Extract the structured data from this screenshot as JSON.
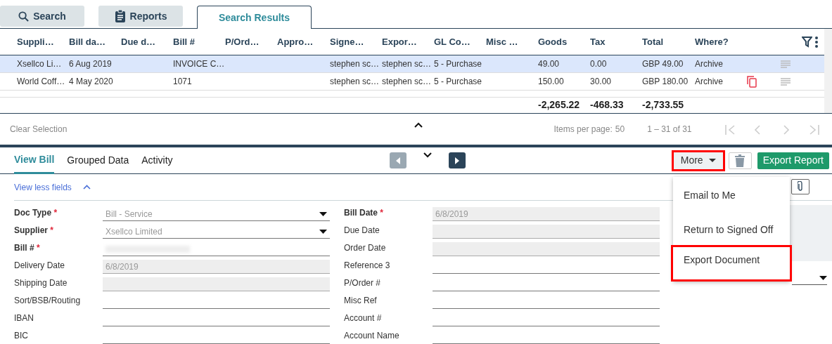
{
  "top_tabs": [
    {
      "label": "Search",
      "selected": false
    },
    {
      "label": "Reports",
      "selected": false
    },
    {
      "label": "Search Results",
      "selected": true
    }
  ],
  "required_marker": "*",
  "table": {
    "columns": [
      "Suppli…",
      "Bill da…",
      "Due d…",
      "Bill #",
      "P/Ord…",
      "Appro…",
      "Signe…",
      "Expor…",
      "GL Co…",
      "Misc …",
      "Goods",
      "Tax",
      "Total",
      "Where?"
    ],
    "rows": [
      {
        "selected": true,
        "copy_flag": false,
        "cells": [
          "Xsellco Li…",
          "6 Aug 2019",
          "",
          "INVOICE C…",
          "",
          "",
          "stephen sc…",
          "stephen sc…",
          "5 - Purchase",
          "",
          "49.00",
          "0.00",
          "GBP 49.00",
          "Archive"
        ]
      },
      {
        "selected": false,
        "copy_flag": true,
        "cells": [
          "World Coff…",
          "4 May 2020",
          "",
          "1071",
          "",
          "",
          "stephen sc…",
          "stephen sc…",
          "5 - Purchase",
          "",
          "150.00",
          "30.00",
          "GBP 180.00",
          "Archive"
        ]
      }
    ],
    "totals": {
      "goods": "-2,265.22",
      "tax": "-468.33",
      "total": "-2,733.55"
    }
  },
  "pager": {
    "clear": "Clear Selection",
    "items_per_page_label": "Items per page:",
    "items_per_page": "50",
    "range": "1 – 31 of 31"
  },
  "detail_tabs": [
    {
      "label": "View Bill",
      "selected": true
    },
    {
      "label": "Grouped Data",
      "selected": false
    },
    {
      "label": "Activity",
      "selected": false
    }
  ],
  "actions": {
    "more": "More",
    "export_report": "Export Report",
    "more_highlighted": true
  },
  "menu": [
    {
      "label": "Email to Me",
      "highlighted": false
    },
    {
      "label": "Return to Signed Off",
      "highlighted": false
    },
    {
      "label": "Export Document",
      "highlighted": true
    }
  ],
  "view_less": "View less fields",
  "left_fields": [
    {
      "label": "Doc Type",
      "required": true,
      "kind": "select",
      "value": "Bill - Service",
      "readonly": false
    },
    {
      "label": "Supplier",
      "required": true,
      "kind": "select",
      "value": "Xsellco Limited",
      "readonly": false
    },
    {
      "label": "Bill #",
      "required": true,
      "kind": "redacted",
      "readonly": false
    },
    {
      "label": "Delivery Date",
      "required": false,
      "kind": "text",
      "value": "6/8/2019",
      "readonly": true
    },
    {
      "label": "Shipping Date",
      "required": false,
      "kind": "text",
      "readonly": true
    },
    {
      "label": "Sort/BSB/Routing",
      "required": false,
      "kind": "text",
      "readonly": false
    },
    {
      "label": "IBAN",
      "required": false,
      "kind": "text",
      "readonly": false
    },
    {
      "label": "BIC",
      "required": false,
      "kind": "text",
      "readonly": false
    }
  ],
  "right_fields": [
    {
      "label": "Bill Date",
      "required": true,
      "value": "6/8/2019",
      "readonly": true
    },
    {
      "label": "Due Date",
      "required": false,
      "readonly": true
    },
    {
      "label": "Order Date",
      "required": false,
      "readonly": true
    },
    {
      "label": "Reference 3",
      "required": false,
      "readonly": false
    },
    {
      "label": "P/Order #",
      "required": false,
      "readonly": false
    },
    {
      "label": "Misc Ref",
      "required": false,
      "readonly": false
    },
    {
      "label": "Account #",
      "required": false,
      "readonly": false
    },
    {
      "label": "Account Name",
      "required": false,
      "readonly": false
    }
  ]
}
